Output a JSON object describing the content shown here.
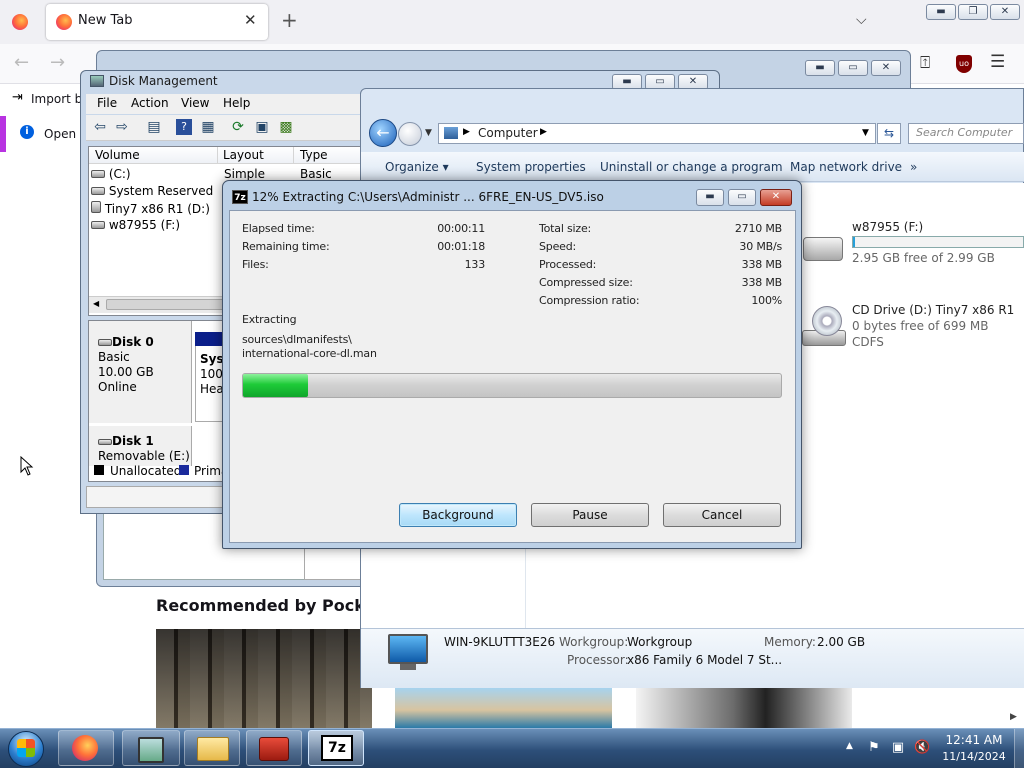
{
  "firefox": {
    "tab_title": "New Tab",
    "tab_close": "✕",
    "new_tab": "+",
    "tab_list": "⌵",
    "nav_back": "←",
    "nav_forward": "→",
    "extensions_icon": "⍐",
    "ublock": "uo",
    "menu_icon": "☰",
    "import_label": "Import b",
    "open_label": "Open p",
    "pocket_title": "Recommended by Pocket",
    "window_controls": {
      "min": "▬",
      "max": "❐",
      "close": "✕"
    }
  },
  "disk_management": {
    "title": "Disk Management",
    "menu": [
      "File",
      "Action",
      "View",
      "Help"
    ],
    "window_controls": {
      "min": "▬",
      "max": "▭",
      "close": "✕"
    },
    "columns": [
      "Volume",
      "Layout",
      "Type"
    ],
    "rows": [
      {
        "volume": "(C:)",
        "layout": "Simple",
        "type": "Basic"
      },
      {
        "volume": "System Reserved",
        "layout": "",
        "type": ""
      },
      {
        "volume": "Tiny7 x86 R1 (D:)",
        "layout": "",
        "type": ""
      },
      {
        "volume": "w87955 (F:)",
        "layout": "",
        "type": ""
      }
    ],
    "disk0": {
      "name": "Disk 0",
      "type": "Basic",
      "size": "10.00 GB",
      "status": "Online"
    },
    "partition_lines": [
      "Syst",
      "100",
      "Hea"
    ],
    "disk1": {
      "name": "Disk 1",
      "type": "Removable (E:)"
    },
    "legend": [
      "Unallocated",
      "Prima"
    ],
    "legend_colors": [
      "#000000",
      "#1a2a9c"
    ]
  },
  "explorer": {
    "address": "Computer",
    "search_placeholder": "Search Computer",
    "commands": [
      "Organize ▾",
      "System properties",
      "Uninstall or change a program",
      "Map network drive",
      "»"
    ],
    "drive_f": {
      "name": "w87955 (F:)",
      "free": "2.95 GB free of 2.99 GB",
      "used_fraction": 0.013
    },
    "drive_d": {
      "name": "CD Drive (D:) Tiny7 x86 R1",
      "free": "0 bytes free of 699 MB",
      "fs": "CDFS"
    },
    "pc_name": "WIN-9KLUTTT3E26",
    "workgroup_label": "Workgroup:",
    "workgroup": "Workgroup",
    "memory_label": "Memory:",
    "memory": "2.00 GB",
    "processor_label": "Processor:",
    "processor": "x86 Family 6 Model 7 St...",
    "scroll_right": "▶"
  },
  "sevenzip": {
    "title_icon": "7z",
    "title": "12% Extracting C:\\Users\\Administr ... 6FRE_EN-US_DV5.iso",
    "window_controls": {
      "min": "▬",
      "max": "▭",
      "close": "✕"
    },
    "elapsed_label": "Elapsed time:",
    "elapsed": "00:00:11",
    "remaining_label": "Remaining time:",
    "remaining": "00:01:18",
    "files_label": "Files:",
    "files": "133",
    "total_label": "Total size:",
    "total": "2710 MB",
    "speed_label": "Speed:",
    "speed": "30 MB/s",
    "processed_label": "Processed:",
    "processed": "338 MB",
    "compressed_label": "Compressed size:",
    "compressed": "338 MB",
    "ratio_label": "Compression ratio:",
    "ratio": "100%",
    "extracting_label": "Extracting",
    "current_dir": "sources\\dlmanifests\\",
    "current_file": "international-core-dl.man",
    "progress_fraction": 0.12,
    "buttons": {
      "background": "Background",
      "pause": "Pause",
      "cancel": "Cancel"
    }
  },
  "taskbar": {
    "time": "12:41 AM",
    "date": "11/14/2024",
    "tray_up": "▲"
  },
  "colors": {
    "progress_green": "#1ecb38",
    "taskbar_blue": "#2d4f79",
    "ublock_red": "#800000"
  }
}
